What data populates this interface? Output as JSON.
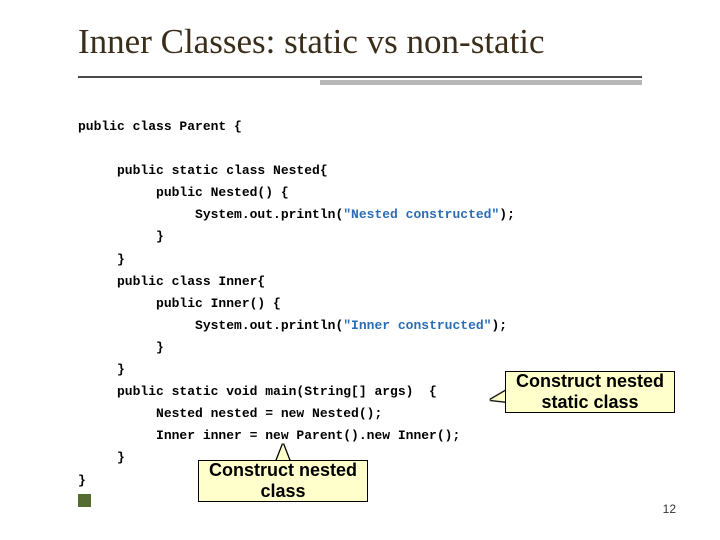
{
  "title": "Inner Classes: static vs non-static",
  "page_number": "12",
  "code": {
    "l01": "public class Parent {",
    "l02": "",
    "l03": "     public static class Nested{",
    "l04": "          public Nested() {",
    "l05a": "               System.out.println(",
    "l05s": "\"Nested constructed\"",
    "l05b": ");",
    "l06": "          }",
    "l07": "     }",
    "l08": "     public class Inner{",
    "l09": "          public Inner() {",
    "l10a": "               System.out.println(",
    "l10s": "\"Inner constructed\"",
    "l10b": ");",
    "l11": "          }",
    "l12": "     }",
    "l13": "     public static void main(String[] args)  {",
    "l14": "          Nested nested = new Nested();",
    "l15": "          Inner inner = new Parent().new Inner();",
    "l16": "     }",
    "l17": "}"
  },
  "callouts": {
    "c1": "Construct nested static class",
    "c2": "Construct nested class"
  }
}
